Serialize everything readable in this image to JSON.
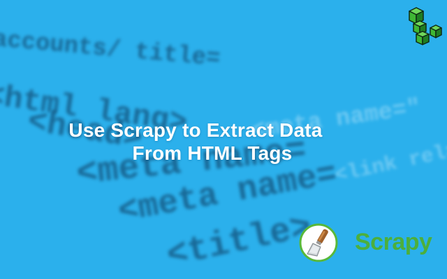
{
  "banner": {
    "title_line1": "Use Scrapy to Extract Data",
    "title_line2": "From HTML Tags",
    "brand_word": "Scrapy",
    "background_color": "#2bb0ec",
    "title_color": "#ffffff",
    "brand_color": "#4caf3c",
    "corner_logo_color": "#3fb634"
  },
  "background_code": {
    "lines": [
      "accounts/ title=",
      "<html lang>",
      "<head>",
      "<meta name=\"",
      "<meta name=",
      "<meta name=",
      "<link rel=",
      "<title>"
    ]
  }
}
